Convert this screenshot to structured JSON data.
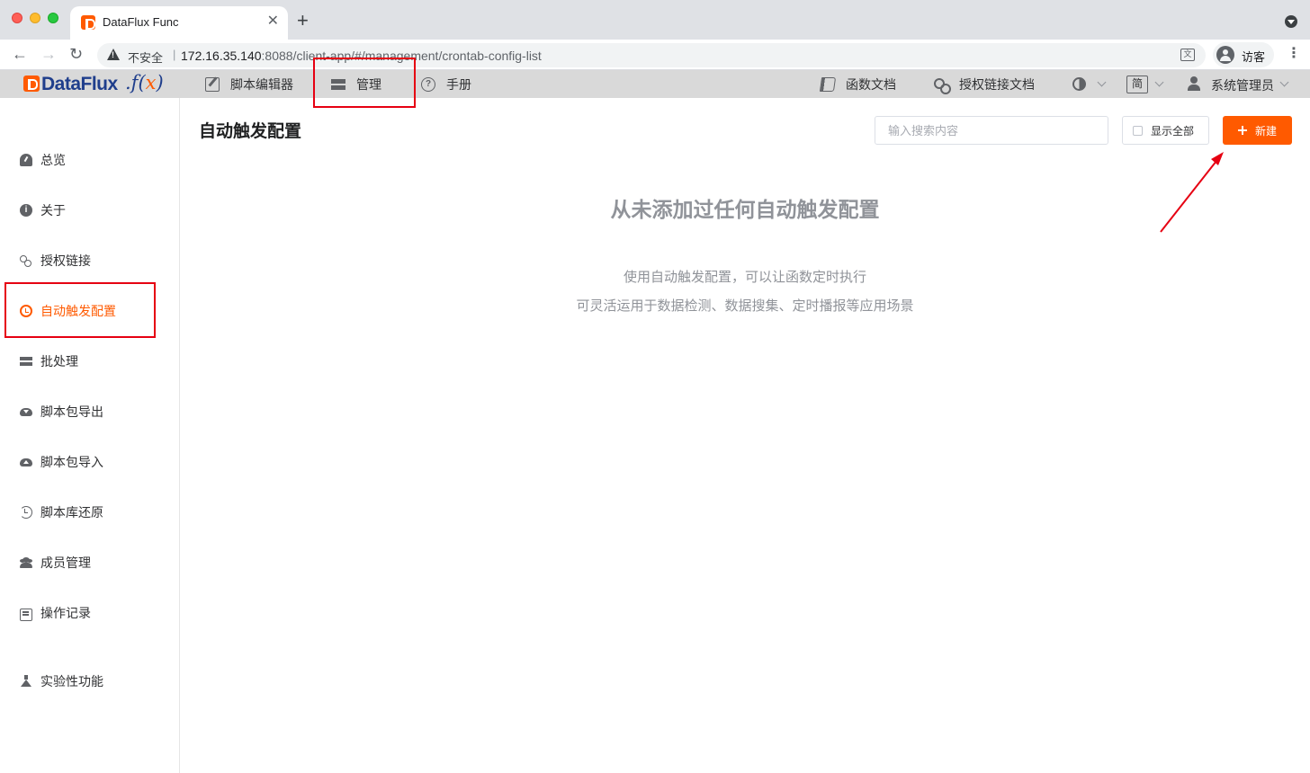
{
  "browser": {
    "tab_title": "DataFlux Func",
    "tab_close": "✕",
    "new_tab": "+",
    "insecure_label": "不安全",
    "url_separator": "|",
    "url_host": "172.16.35.140",
    "url_rest": ":8088/client-app/#/management/crontab-config-list",
    "translate_glyph": "文",
    "profile_label": "访客",
    "menu_glyph": "⋮",
    "back_glyph": "←",
    "forward_glyph": "→",
    "reload_glyph": "↻"
  },
  "appbar": {
    "logo_text": "DataFlux",
    "logo_fx_prefix": ".f(",
    "logo_fx_x": "x",
    "logo_fx_suffix": ")",
    "nav": [
      {
        "label": "脚本编辑器",
        "icon": "edit-icon"
      },
      {
        "label": "管理",
        "icon": "server-icon"
      },
      {
        "label": "手册",
        "icon": "help-icon"
      },
      {
        "label": "函数文档",
        "icon": "book-icon"
      },
      {
        "label": "授权链接文档",
        "icon": "link-icon"
      }
    ],
    "lang": "简",
    "user_name": "系统管理员"
  },
  "sidebar": {
    "items": [
      {
        "label": "总览",
        "icon": "dashboard-icon"
      },
      {
        "label": "关于",
        "icon": "info-icon"
      },
      {
        "label": "授权链接",
        "icon": "link-icon"
      },
      {
        "label": "自动触发配置",
        "icon": "clock-icon",
        "active": true
      },
      {
        "label": "批处理",
        "icon": "batch-icon"
      },
      {
        "label": "脚本包导出",
        "icon": "cloud-download-icon"
      },
      {
        "label": "脚本包导入",
        "icon": "cloud-upload-icon"
      },
      {
        "label": "脚本库还原",
        "icon": "history-icon"
      },
      {
        "label": "成员管理",
        "icon": "users-icon"
      },
      {
        "label": "操作记录",
        "icon": "keyboard-icon"
      },
      {
        "label": "实验性功能",
        "icon": "flask-icon"
      }
    ]
  },
  "main": {
    "title": "自动触发配置",
    "search_placeholder": "输入搜索内容",
    "search_value": "",
    "show_all_label": "显示全部",
    "show_all_checked": false,
    "new_button_label": "新建",
    "empty_title": "从未添加过任何自动触发配置",
    "empty_desc_1": "使用自动触发配置，可以让函数定时执行",
    "empty_desc_2": "可灵活运用于数据检测、数据搜集、定时播报等应用场景"
  },
  "colors": {
    "brand": "#ff5a00",
    "logo_blue": "#1f3e8c",
    "annotation_red": "#e60012"
  }
}
